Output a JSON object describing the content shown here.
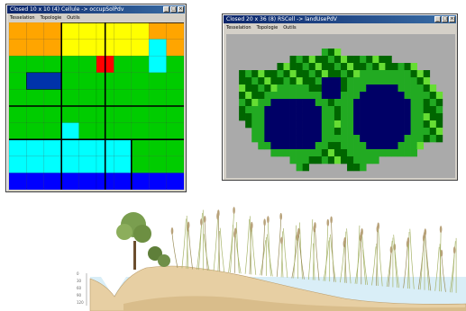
{
  "window1": {
    "title": "Closed 10 x 10 (4)  Cellule -> occupSolPdv",
    "menu": [
      "Tesselation",
      "Topologie",
      "Outils"
    ],
    "buttons": [
      "_",
      "□",
      "×"
    ]
  },
  "window2": {
    "title": "Closed 20 x 36 (8)  RSCell -> landUsePdV",
    "menu": [
      "Tesselation",
      "Topologie",
      "Outils"
    ],
    "buttons": [
      "_",
      "□",
      "×"
    ]
  },
  "colors": {
    "orange": "#ffa500",
    "yellow": "#ffff00",
    "green": "#00cc00",
    "red": "#ff0000",
    "blue": "#0000ff",
    "navy": "#0033aa",
    "cyan": "#00ffff",
    "grey_bg": "#aaaaaa",
    "dark_navy": "#000066",
    "forest": "#006600",
    "leaf": "#22aa22",
    "lime": "#66dd33"
  },
  "depth_scale": [
    "0",
    "30",
    "60",
    "90",
    "120"
  ]
}
